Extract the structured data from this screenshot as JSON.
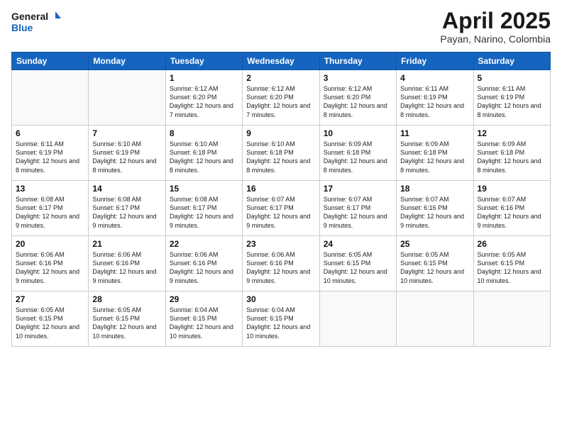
{
  "header": {
    "logo_line1": "General",
    "logo_line2": "Blue",
    "title": "April 2025",
    "subtitle": "Payan, Narino, Colombia"
  },
  "days_of_week": [
    "Sunday",
    "Monday",
    "Tuesday",
    "Wednesday",
    "Thursday",
    "Friday",
    "Saturday"
  ],
  "weeks": [
    [
      {
        "day": "",
        "info": ""
      },
      {
        "day": "",
        "info": ""
      },
      {
        "day": "1",
        "info": "Sunrise: 6:12 AM\nSunset: 6:20 PM\nDaylight: 12 hours and 7 minutes."
      },
      {
        "day": "2",
        "info": "Sunrise: 6:12 AM\nSunset: 6:20 PM\nDaylight: 12 hours and 7 minutes."
      },
      {
        "day": "3",
        "info": "Sunrise: 6:12 AM\nSunset: 6:20 PM\nDaylight: 12 hours and 8 minutes."
      },
      {
        "day": "4",
        "info": "Sunrise: 6:11 AM\nSunset: 6:19 PM\nDaylight: 12 hours and 8 minutes."
      },
      {
        "day": "5",
        "info": "Sunrise: 6:11 AM\nSunset: 6:19 PM\nDaylight: 12 hours and 8 minutes."
      }
    ],
    [
      {
        "day": "6",
        "info": "Sunrise: 6:11 AM\nSunset: 6:19 PM\nDaylight: 12 hours and 8 minutes."
      },
      {
        "day": "7",
        "info": "Sunrise: 6:10 AM\nSunset: 6:19 PM\nDaylight: 12 hours and 8 minutes."
      },
      {
        "day": "8",
        "info": "Sunrise: 6:10 AM\nSunset: 6:18 PM\nDaylight: 12 hours and 8 minutes."
      },
      {
        "day": "9",
        "info": "Sunrise: 6:10 AM\nSunset: 6:18 PM\nDaylight: 12 hours and 8 minutes."
      },
      {
        "day": "10",
        "info": "Sunrise: 6:09 AM\nSunset: 6:18 PM\nDaylight: 12 hours and 8 minutes."
      },
      {
        "day": "11",
        "info": "Sunrise: 6:09 AM\nSunset: 6:18 PM\nDaylight: 12 hours and 8 minutes."
      },
      {
        "day": "12",
        "info": "Sunrise: 6:09 AM\nSunset: 6:18 PM\nDaylight: 12 hours and 8 minutes."
      }
    ],
    [
      {
        "day": "13",
        "info": "Sunrise: 6:08 AM\nSunset: 6:17 PM\nDaylight: 12 hours and 9 minutes."
      },
      {
        "day": "14",
        "info": "Sunrise: 6:08 AM\nSunset: 6:17 PM\nDaylight: 12 hours and 9 minutes."
      },
      {
        "day": "15",
        "info": "Sunrise: 6:08 AM\nSunset: 6:17 PM\nDaylight: 12 hours and 9 minutes."
      },
      {
        "day": "16",
        "info": "Sunrise: 6:07 AM\nSunset: 6:17 PM\nDaylight: 12 hours and 9 minutes."
      },
      {
        "day": "17",
        "info": "Sunrise: 6:07 AM\nSunset: 6:17 PM\nDaylight: 12 hours and 9 minutes."
      },
      {
        "day": "18",
        "info": "Sunrise: 6:07 AM\nSunset: 6:16 PM\nDaylight: 12 hours and 9 minutes."
      },
      {
        "day": "19",
        "info": "Sunrise: 6:07 AM\nSunset: 6:16 PM\nDaylight: 12 hours and 9 minutes."
      }
    ],
    [
      {
        "day": "20",
        "info": "Sunrise: 6:06 AM\nSunset: 6:16 PM\nDaylight: 12 hours and 9 minutes."
      },
      {
        "day": "21",
        "info": "Sunrise: 6:06 AM\nSunset: 6:16 PM\nDaylight: 12 hours and 9 minutes."
      },
      {
        "day": "22",
        "info": "Sunrise: 6:06 AM\nSunset: 6:16 PM\nDaylight: 12 hours and 9 minutes."
      },
      {
        "day": "23",
        "info": "Sunrise: 6:06 AM\nSunset: 6:16 PM\nDaylight: 12 hours and 9 minutes."
      },
      {
        "day": "24",
        "info": "Sunrise: 6:05 AM\nSunset: 6:15 PM\nDaylight: 12 hours and 10 minutes."
      },
      {
        "day": "25",
        "info": "Sunrise: 6:05 AM\nSunset: 6:15 PM\nDaylight: 12 hours and 10 minutes."
      },
      {
        "day": "26",
        "info": "Sunrise: 6:05 AM\nSunset: 6:15 PM\nDaylight: 12 hours and 10 minutes."
      }
    ],
    [
      {
        "day": "27",
        "info": "Sunrise: 6:05 AM\nSunset: 6:15 PM\nDaylight: 12 hours and 10 minutes."
      },
      {
        "day": "28",
        "info": "Sunrise: 6:05 AM\nSunset: 6:15 PM\nDaylight: 12 hours and 10 minutes."
      },
      {
        "day": "29",
        "info": "Sunrise: 6:04 AM\nSunset: 6:15 PM\nDaylight: 12 hours and 10 minutes."
      },
      {
        "day": "30",
        "info": "Sunrise: 6:04 AM\nSunset: 6:15 PM\nDaylight: 12 hours and 10 minutes."
      },
      {
        "day": "",
        "info": ""
      },
      {
        "day": "",
        "info": ""
      },
      {
        "day": "",
        "info": ""
      }
    ]
  ]
}
